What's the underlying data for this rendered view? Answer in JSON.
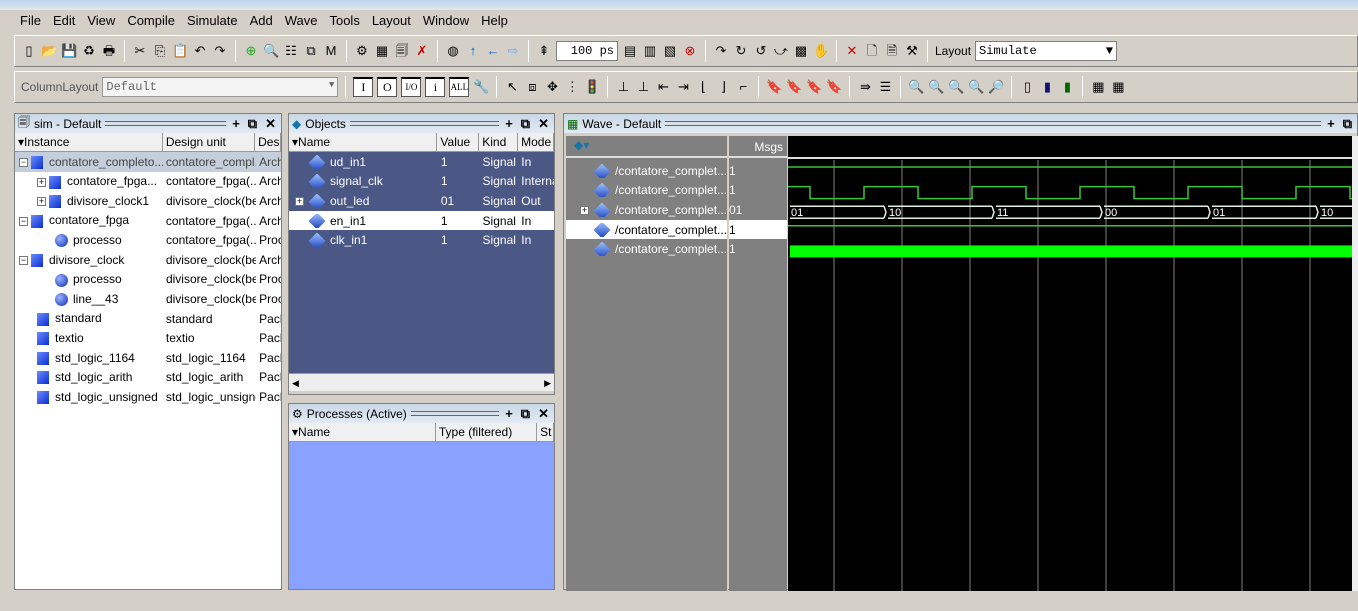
{
  "menu": [
    "File",
    "Edit",
    "View",
    "Compile",
    "Simulate",
    "Add",
    "Wave",
    "Tools",
    "Layout",
    "Window",
    "Help"
  ],
  "toolbar": {
    "time_value": "100 ps",
    "layout_label": "Layout",
    "layout_value": "Simulate",
    "column_layout_label": "ColumnLayout",
    "column_layout_value": "Default",
    "filters": [
      "I",
      "O",
      "I/O",
      "i",
      "ALL"
    ]
  },
  "sim": {
    "title": "sim - Default",
    "columns": [
      "Instance",
      "Design unit",
      "Desi"
    ],
    "rows": [
      {
        "name": "contatore_completo...",
        "unit": "contatore_compl...",
        "type": "Arch",
        "level": 0,
        "exp": "-",
        "icon": "sq",
        "sel": true
      },
      {
        "name": "contatore_fpga...",
        "unit": "contatore_fpga(...",
        "type": "Arch",
        "level": 1,
        "exp": "+",
        "icon": "sq"
      },
      {
        "name": "divisore_clock1",
        "unit": "divisore_clock(be...",
        "type": "Arch",
        "level": 1,
        "exp": "+",
        "icon": "sq"
      },
      {
        "name": "contatore_fpga",
        "unit": "contatore_fpga(...",
        "type": "Arch",
        "level": 0,
        "exp": "-",
        "icon": "sq"
      },
      {
        "name": "processo",
        "unit": "contatore_fpga(...",
        "type": "Proc",
        "level": 1,
        "exp": "",
        "icon": "ball"
      },
      {
        "name": "divisore_clock",
        "unit": "divisore_clock(be...",
        "type": "Arch",
        "level": 0,
        "exp": "-",
        "icon": "sq"
      },
      {
        "name": "processo",
        "unit": "divisore_clock(be...",
        "type": "Proc",
        "level": 1,
        "exp": "",
        "icon": "ball"
      },
      {
        "name": "line__43",
        "unit": "divisore_clock(be...",
        "type": "Proc",
        "level": 1,
        "exp": "",
        "icon": "ball"
      },
      {
        "name": "standard",
        "unit": "standard",
        "type": "Pack",
        "level": 0,
        "exp": "",
        "icon": "sq"
      },
      {
        "name": "textio",
        "unit": "textio",
        "type": "Pack",
        "level": 0,
        "exp": "",
        "icon": "sq"
      },
      {
        "name": "std_logic_1164",
        "unit": "std_logic_1164",
        "type": "Pack",
        "level": 0,
        "exp": "",
        "icon": "sq"
      },
      {
        "name": "std_logic_arith",
        "unit": "std_logic_arith",
        "type": "Pack",
        "level": 0,
        "exp": "",
        "icon": "sq"
      },
      {
        "name": "std_logic_unsigned",
        "unit": "std_logic_unsigned",
        "type": "Pack",
        "level": 0,
        "exp": "",
        "icon": "sq"
      }
    ]
  },
  "objects": {
    "title": "Objects",
    "columns": [
      "Name",
      "Value",
      "Kind",
      "Mode"
    ],
    "rows": [
      {
        "name": "ud_in1",
        "value": "1",
        "kind": "Signal",
        "mode": "In"
      },
      {
        "name": "signal_clk",
        "value": "1",
        "kind": "Signal",
        "mode": "Internal"
      },
      {
        "name": "out_led",
        "value": "01",
        "kind": "Signal",
        "mode": "Out",
        "exp": "+"
      },
      {
        "name": "en_in1",
        "value": "1",
        "kind": "Signal",
        "mode": "In",
        "sel": true
      },
      {
        "name": "clk_in1",
        "value": "1",
        "kind": "Signal",
        "mode": "In"
      }
    ]
  },
  "processes": {
    "title": "Processes (Active)",
    "columns": [
      "Name",
      "Type (filtered)",
      "St"
    ]
  },
  "wave": {
    "title": "Wave - Default",
    "msgs_label": "Msgs",
    "signals": [
      {
        "name": "/contatore_complet...",
        "value": "1",
        "kind": "const_high"
      },
      {
        "name": "/contatore_complet...",
        "value": "1",
        "kind": "clock"
      },
      {
        "name": "/contatore_complet...",
        "value": "01",
        "kind": "bus",
        "segments": [
          "01",
          "10",
          "11",
          "00",
          "01",
          "10"
        ],
        "exp": "+"
      },
      {
        "name": "/contatore_complet...",
        "value": "1",
        "kind": "const_high",
        "sel": true
      },
      {
        "name": "/contatore_complet...",
        "value": "1",
        "kind": "fast_clock"
      }
    ],
    "colors": {
      "bg": "#000000",
      "signal": "#3ac43a",
      "fast": "#00ff00",
      "bus": "#e0f0e0",
      "grid": "#808080"
    }
  }
}
